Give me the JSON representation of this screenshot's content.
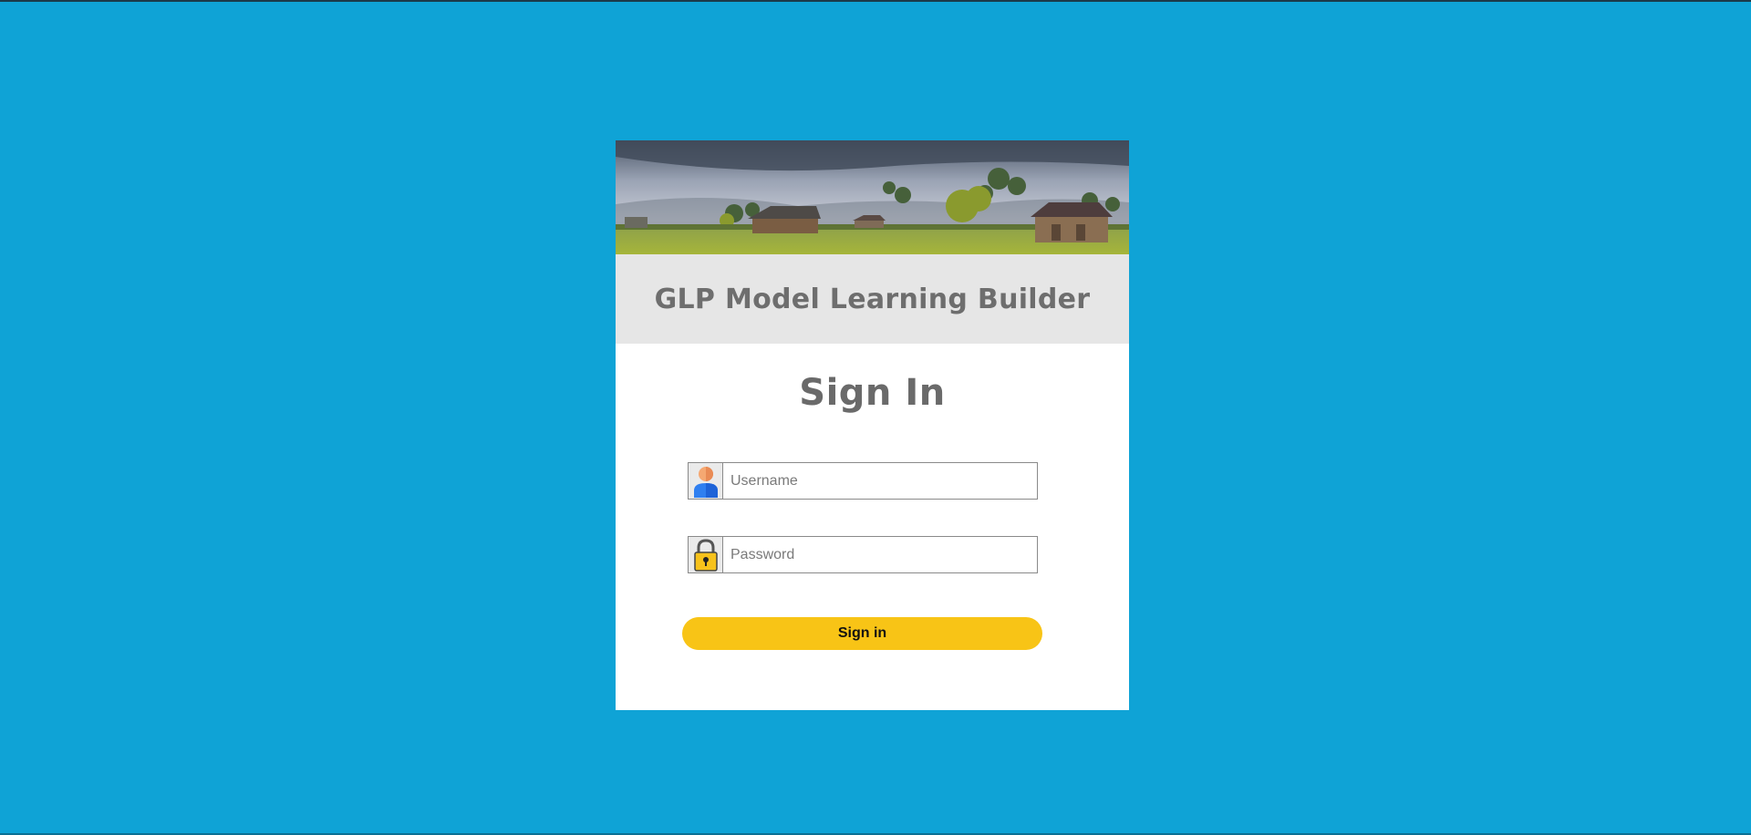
{
  "app": {
    "title": "GLP Model Learning Builder"
  },
  "form": {
    "heading": "Sign In",
    "username": {
      "value": "",
      "placeholder": "Username",
      "icon": "user-icon"
    },
    "password": {
      "value": "",
      "placeholder": "Password",
      "icon": "padlock-icon"
    },
    "submit_label": "Sign in"
  },
  "colors": {
    "background": "#0fa3d6",
    "title_bar": "#e6e6e6",
    "button": "#f8c416",
    "heading_text": "#6a6a6a"
  }
}
